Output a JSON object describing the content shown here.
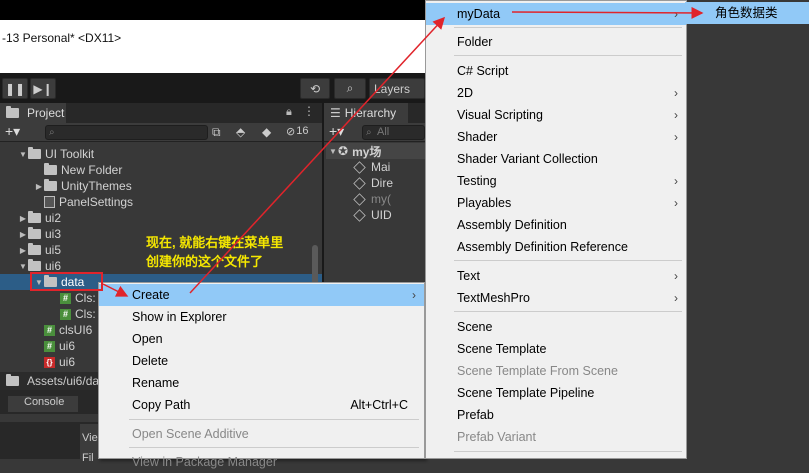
{
  "window": {
    "title": "-13 Personal* <DX11>"
  },
  "toolbar": {
    "layers_label": "Layers"
  },
  "project": {
    "tab_label": "Project",
    "search_count": "16",
    "tree": [
      {
        "label": "UI Toolkit",
        "type": "folder",
        "open": true
      },
      {
        "label": "New Folder",
        "type": "folder"
      },
      {
        "label": "UnityThemes",
        "type": "folder",
        "collapsed": true
      },
      {
        "label": "PanelSettings",
        "type": "asset"
      },
      {
        "label": "ui2",
        "type": "folder",
        "collapsed": true
      },
      {
        "label": "ui3",
        "type": "folder",
        "collapsed": true
      },
      {
        "label": "ui5",
        "type": "folder",
        "collapsed": true
      },
      {
        "label": "ui6",
        "type": "folder",
        "open": true
      },
      {
        "label": "data",
        "type": "folder",
        "open": true,
        "selected": true
      },
      {
        "label": "Cls:",
        "type": "cs"
      },
      {
        "label": "Cls:",
        "type": "cs"
      },
      {
        "label": "clsUI6",
        "type": "cs"
      },
      {
        "label": "ui6",
        "type": "cs"
      },
      {
        "label": "ui6",
        "type": "json"
      }
    ],
    "path": "Assets/ui6/da"
  },
  "hierarchy": {
    "tab_label": "Hierarchy",
    "search_placeholder": "All",
    "rows": [
      {
        "label": "my场",
        "bold": true
      },
      {
        "label": "Mai"
      },
      {
        "label": "Dire"
      },
      {
        "label": "my(",
        "dim": true
      },
      {
        "label": "UID"
      }
    ]
  },
  "console": {
    "tab_label": "Console",
    "vie": "Vie",
    "fil": "Fil"
  },
  "context_menu": {
    "items": [
      {
        "label": "Create",
        "submenu": true,
        "active": true
      },
      {
        "label": "Show in Explorer"
      },
      {
        "label": "Open"
      },
      {
        "label": "Delete"
      },
      {
        "label": "Rename"
      },
      {
        "label": "Copy Path",
        "shortcut": "Alt+Ctrl+C"
      },
      {
        "label": "Open Scene Additive",
        "disabled": true
      },
      {
        "label": "View in Package Manager",
        "disabled": true
      }
    ]
  },
  "create_submenu": {
    "items": [
      {
        "label": "myData",
        "submenu": true,
        "active": true
      },
      {
        "label": "Folder"
      },
      {
        "label": "C# Script"
      },
      {
        "label": "2D",
        "submenu": true
      },
      {
        "label": "Visual Scripting",
        "submenu": true
      },
      {
        "label": "Shader",
        "submenu": true
      },
      {
        "label": "Shader Variant Collection"
      },
      {
        "label": "Testing",
        "submenu": true
      },
      {
        "label": "Playables",
        "submenu": true
      },
      {
        "label": "Assembly Definition"
      },
      {
        "label": "Assembly Definition Reference"
      },
      {
        "label": "Text",
        "submenu": true
      },
      {
        "label": "TextMeshPro",
        "submenu": true
      },
      {
        "label": "Scene"
      },
      {
        "label": "Scene Template"
      },
      {
        "label": "Scene Template From Scene",
        "disabled": true
      },
      {
        "label": "Scene Template Pipeline"
      },
      {
        "label": "Prefab"
      },
      {
        "label": "Prefab Variant",
        "disabled": true
      }
    ]
  },
  "mydata_submenu": {
    "item": "角色数据类"
  },
  "annotation": {
    "line1": "现在, 就能右键在菜单里",
    "line2": "创建你的这个文件了",
    "color": "#e0242b",
    "text_color": "#f5e700"
  },
  "colors": {
    "menu_highlight": "#91c9f7",
    "selection": "#2c5d87",
    "editor_bg": "#383838"
  }
}
